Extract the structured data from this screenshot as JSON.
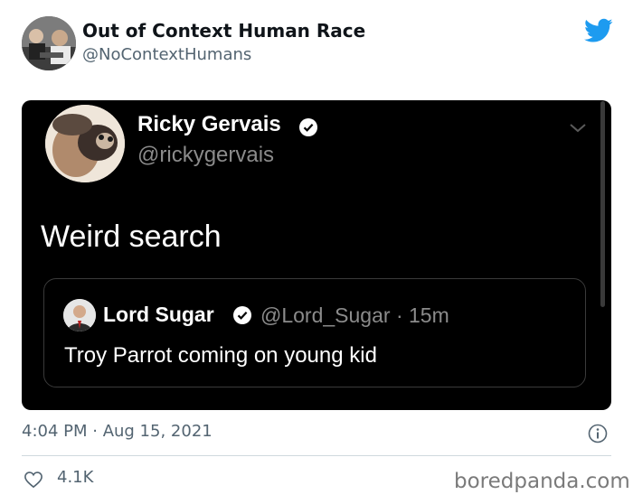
{
  "tweet": {
    "account_name": "Out of Context Human Race",
    "account_handle": "@NoContextHumans",
    "timestamp": "4:04 PM · Aug 15, 2021",
    "like_count": "4.1K"
  },
  "embedded_tweet": {
    "author_name": "Ricky Gervais",
    "author_handle": "@rickygervais",
    "text": "Weird search",
    "quoted": {
      "author_name": "Lord Sugar",
      "meta": "@Lord_Sugar · 15m",
      "text": "Troy Parrot coming on young kid"
    }
  },
  "watermark": "boredpanda.com",
  "colors": {
    "twitter_blue": "#1d9bf0",
    "embed_background": "#000000",
    "secondary_text": "#536471"
  },
  "icons": [
    "twitter-bird-icon",
    "verified-badge-icon",
    "chevron-down-icon",
    "info-icon",
    "heart-icon"
  ]
}
